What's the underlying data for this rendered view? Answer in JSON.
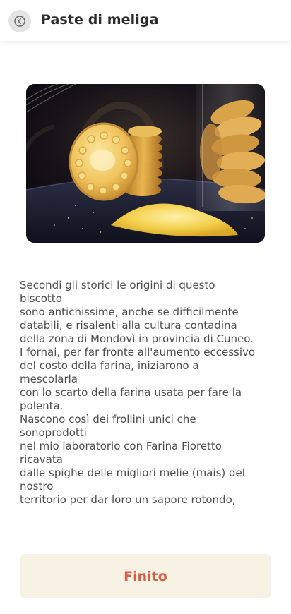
{
  "header": {
    "title": "Paste di meliga",
    "back_icon": "back-arrow-circle-icon"
  },
  "hero_image": {
    "subject": "paste di meliga cookies with corn flour"
  },
  "description": {
    "lines": [
      "Secondi gli storici le origini di questo",
      "biscotto",
      "sono antichissime, anche se difficilmente",
      "databili, e risalenti alla cultura contadina",
      "della zona di Mondovì in provincia di Cuneo.",
      "I fornai, per far fronte all'aumento eccessivo",
      "del costo della farina, iniziarono a",
      "mescolarla",
      "con lo scarto della farina usata per fare la",
      "polenta.",
      "Nascono così dei frollini unici che",
      "sonoprodotti",
      "nel mio laboratorio con Farina Fioretto",
      "ricavata",
      "dalle spighe delle migliori melie (mais) del",
      "nostro",
      "territorio per dar loro un sapore rotondo,"
    ]
  },
  "footer": {
    "done_label": "Finito"
  },
  "colors": {
    "accent_text": "#d95c45",
    "button_bg": "#f7f2e3",
    "body_text": "#4d4d4d"
  }
}
